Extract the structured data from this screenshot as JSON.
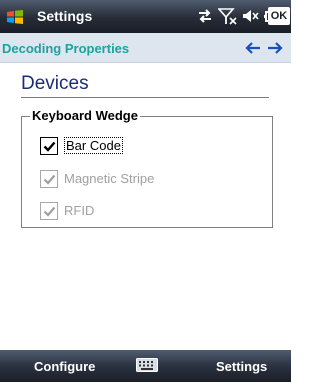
{
  "titlebar": {
    "title": "Settings",
    "ok_label": "OK",
    "start_icon": "windows-flag-icon",
    "status_icons": [
      "connectivity-icon",
      "signal-off-icon",
      "speaker-mute-icon",
      "battery-icon"
    ]
  },
  "header": {
    "title": "Decoding Properties",
    "back_icon": "arrow-left-icon",
    "forward_icon": "arrow-right-icon"
  },
  "content": {
    "heading": "Devices",
    "group_title": "Keyboard Wedge",
    "options": [
      {
        "label": "Bar Code",
        "checked": true,
        "enabled": true
      },
      {
        "label": "Magnetic Stripe",
        "checked": true,
        "enabled": false
      },
      {
        "label": "RFID",
        "checked": true,
        "enabled": false
      }
    ]
  },
  "menubar": {
    "left_label": "Configure",
    "right_label": "Settings",
    "center_icon": "keyboard-icon"
  },
  "colors": {
    "header_title": "#1ca3a0",
    "heading": "#1c2c7a",
    "disabled_text": "#a0a0a0",
    "bar_dark": "#1a1e27"
  }
}
